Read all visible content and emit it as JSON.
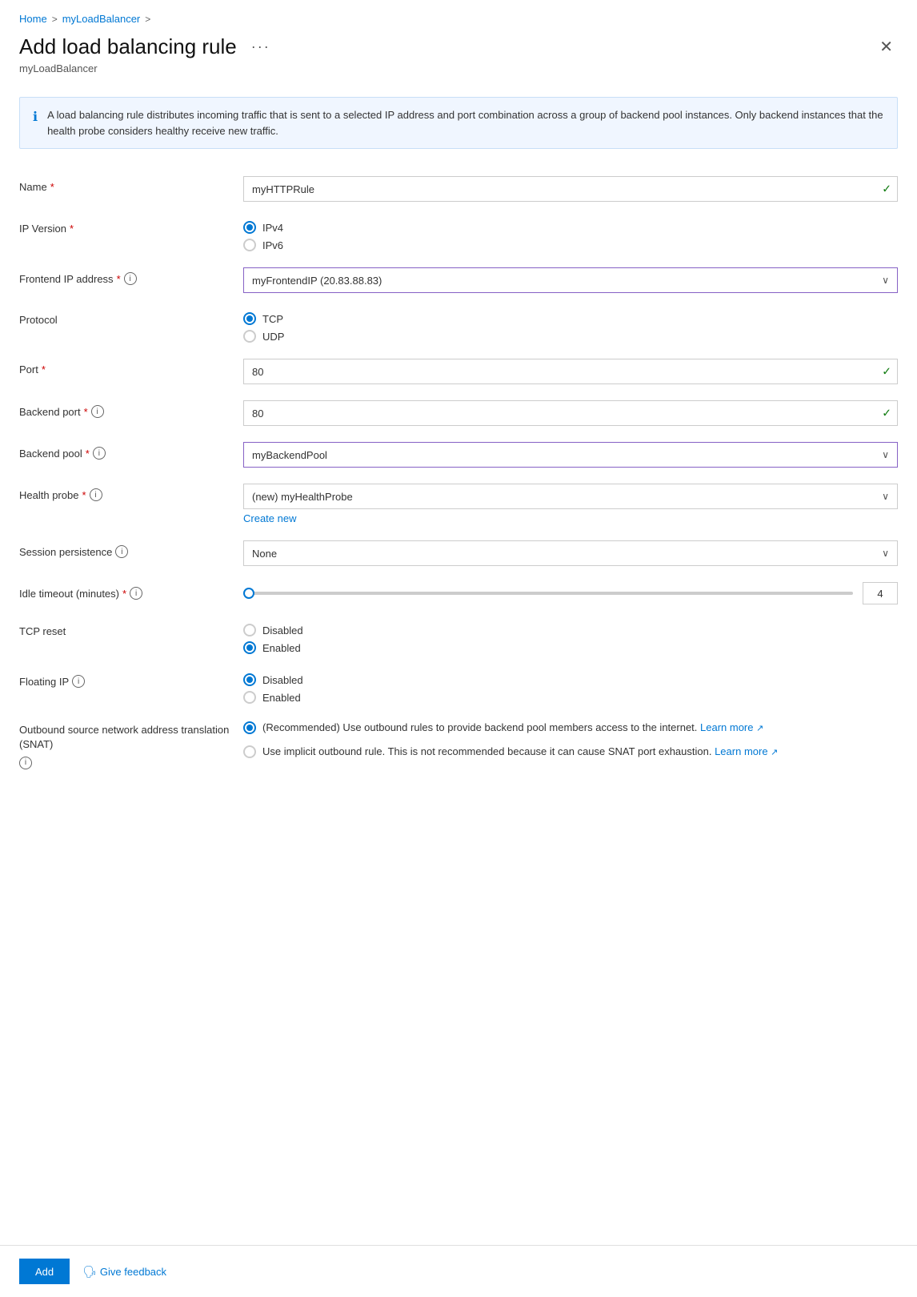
{
  "breadcrumb": {
    "home": "Home",
    "sep1": ">",
    "loadbalancer": "myLoadBalancer",
    "sep2": ">"
  },
  "header": {
    "title": "Add load balancing rule",
    "ellipsis": "···",
    "subtitle": "myLoadBalancer"
  },
  "info_banner": {
    "text": "A load balancing rule distributes incoming traffic that is sent to a selected IP address and port combination across a group of backend pool instances. Only backend instances that the health probe considers healthy receive new traffic."
  },
  "form": {
    "name": {
      "label": "Name",
      "required": true,
      "value": "myHTTPRule",
      "has_check": true
    },
    "ip_version": {
      "label": "IP Version",
      "required": true,
      "options": [
        {
          "value": "IPv4",
          "checked": true
        },
        {
          "value": "IPv6",
          "checked": false
        }
      ]
    },
    "frontend_ip": {
      "label": "Frontend IP address",
      "required": true,
      "has_info": true,
      "value": "myFrontendIP (20.83.88.83)"
    },
    "protocol": {
      "label": "Protocol",
      "options": [
        {
          "value": "TCP",
          "checked": true
        },
        {
          "value": "UDP",
          "checked": false
        }
      ]
    },
    "port": {
      "label": "Port",
      "required": true,
      "value": "80",
      "has_check": true
    },
    "backend_port": {
      "label": "Backend port",
      "required": true,
      "has_info": true,
      "value": "80",
      "has_check": true
    },
    "backend_pool": {
      "label": "Backend pool",
      "required": true,
      "has_info": true,
      "value": "myBackendPool"
    },
    "health_probe": {
      "label": "Health probe",
      "required": true,
      "has_info": true,
      "value": "(new) myHealthProbe",
      "create_new": "Create new"
    },
    "session_persistence": {
      "label": "Session persistence",
      "has_info": true,
      "value": "None"
    },
    "idle_timeout": {
      "label": "Idle timeout (minutes)",
      "required": true,
      "has_info": true,
      "value": "4",
      "slider_percent": 0
    },
    "tcp_reset": {
      "label": "TCP reset",
      "options": [
        {
          "value": "Disabled",
          "checked": false
        },
        {
          "value": "Enabled",
          "checked": true
        }
      ]
    },
    "floating_ip": {
      "label": "Floating IP",
      "has_info": true,
      "options": [
        {
          "value": "Disabled",
          "checked": true
        },
        {
          "value": "Enabled",
          "checked": false
        }
      ]
    },
    "outbound_snat": {
      "label": "Outbound source network address translation (SNAT)",
      "has_info": true,
      "options": [
        {
          "checked": true,
          "text": "(Recommended) Use outbound rules to provide backend pool members access to the internet.",
          "link": "Learn more",
          "link_url": "#"
        },
        {
          "checked": false,
          "text": "Use implicit outbound rule. This is not recommended because it can cause SNAT port exhaustion.",
          "link": "Learn more",
          "link_url": "#"
        }
      ]
    }
  },
  "footer": {
    "add_label": "Add",
    "feedback_label": "Give feedback"
  }
}
